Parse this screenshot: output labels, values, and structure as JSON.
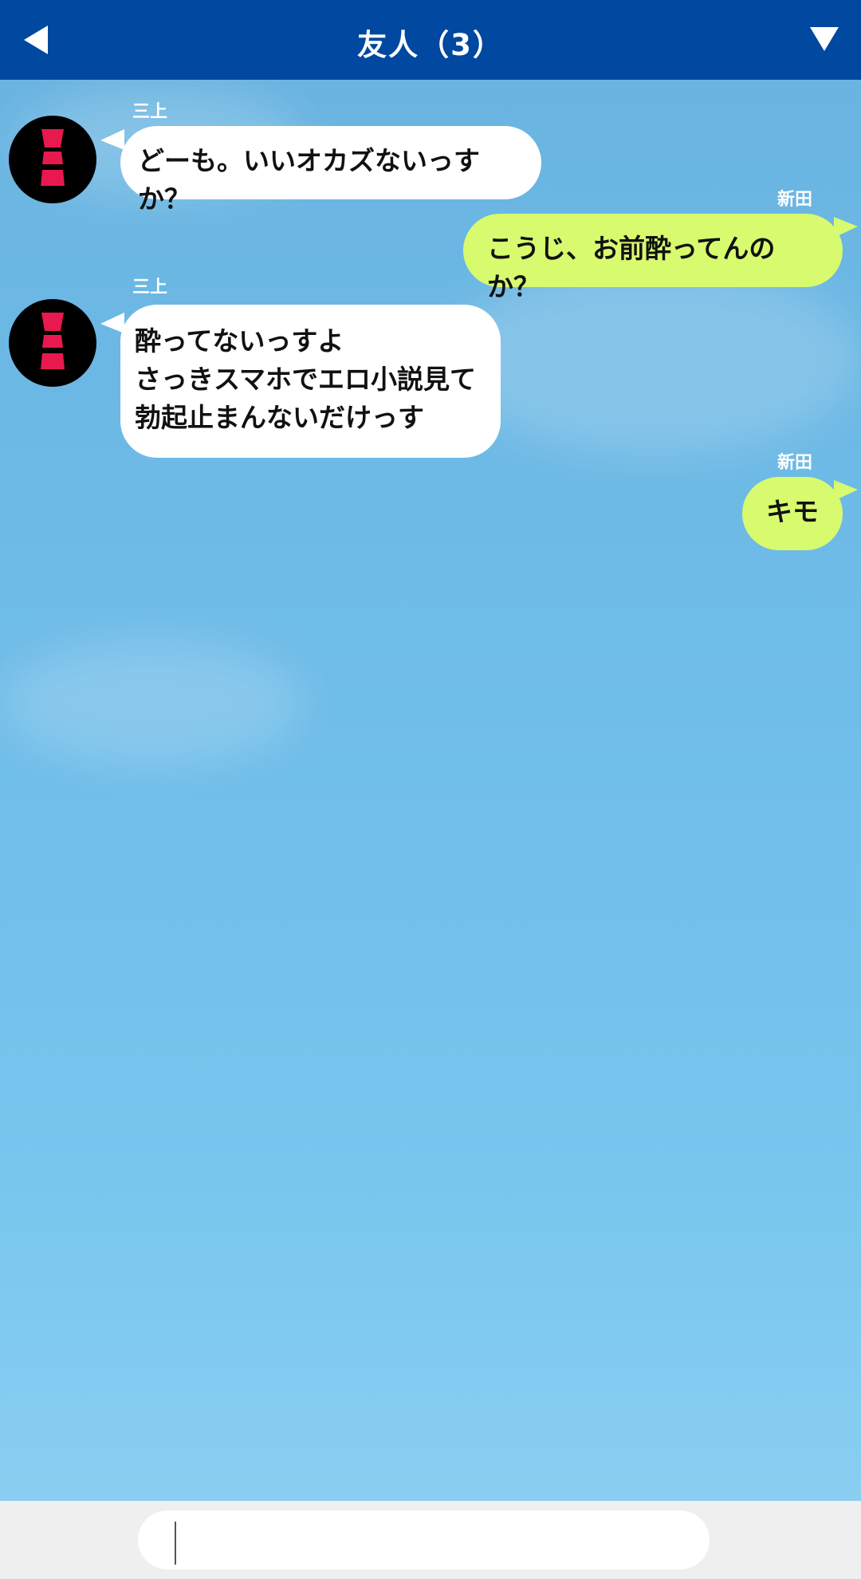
{
  "header": {
    "title": "友人（3）",
    "back_icon": "back-triangle-icon",
    "menu_icon": "menu-down-triangle-icon",
    "background_color": "#0048a0"
  },
  "messages": [
    {
      "side": "left",
      "sender": "三上",
      "text": "どーも。いいオカズないっすか？"
    },
    {
      "side": "right",
      "sender": "新田",
      "text": "こうじ、お前酔ってんのか？"
    },
    {
      "side": "left",
      "sender": "三上",
      "text": "酔ってないっすよ\nさっきスマホでエロ小説見て\n勃起止まんないだけっす"
    },
    {
      "side": "right",
      "sender": "新田",
      "text": "キモ"
    }
  ],
  "colors": {
    "incoming_bubble": "#ffffff",
    "outgoing_bubble": "#d8fa6e",
    "avatar_accent": "#e8194e"
  },
  "input": {
    "value": "",
    "placeholder": ""
  }
}
